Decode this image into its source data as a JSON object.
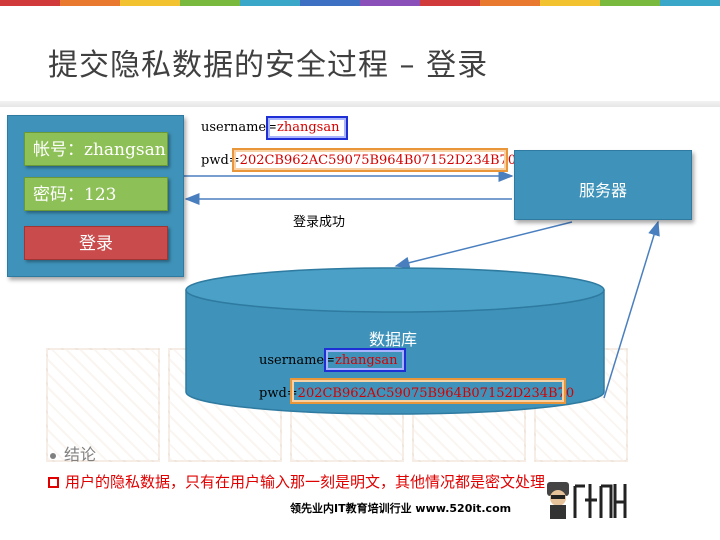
{
  "title": "提交隐私数据的安全过程  –  登录",
  "colors": {
    "panel": "#3f93ba",
    "field": "#8dc056",
    "button": "#c94b4b",
    "highlight_red": "#d40000"
  },
  "login_form": {
    "account": "帐号：zhangsan",
    "password": "密码：123",
    "login_button": "登录"
  },
  "request": {
    "username_key": "username=",
    "username_value": "zhangsan",
    "pwd_key": "pwd=",
    "pwd_value": "202CB962AC59075B964B07152D234B70"
  },
  "response_label": "登录成功",
  "server_label": "服务器",
  "database": {
    "label": "数据库",
    "username_key": "username=",
    "username_value": "zhangsan",
    "pwd_key": "pwd=",
    "pwd_value": "202CB962AC59075B964B07152D234B70"
  },
  "bullets": {
    "conclusion": "结论",
    "statement": "用户的隐私数据，只有在用户输入那一刻是明文，其他情况都是密文处理"
  },
  "footer": "领先业内IT教育培训行业 www.520it.com",
  "logo_icon": "mascot-logo-icon"
}
